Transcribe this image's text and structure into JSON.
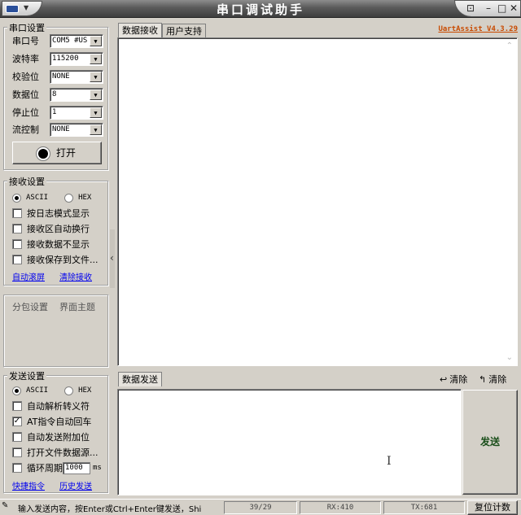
{
  "window": {
    "title": "串口调试助手"
  },
  "serial": {
    "group_title": "串口设置",
    "port_label": "串口号",
    "port_value": "COM5 #US",
    "baud_label": "波特率",
    "baud_value": "115200",
    "parity_label": "校验位",
    "parity_value": "NONE",
    "databits_label": "数据位",
    "databits_value": "8",
    "stopbits_label": "停止位",
    "stopbits_value": "1",
    "flow_label": "流控制",
    "flow_value": "NONE",
    "open_label": "打开"
  },
  "receive": {
    "group_title": "接收设置",
    "ascii": "ASCII",
    "hex": "HEX",
    "opt1": "按日志模式显示",
    "opt2": "接收区自动换行",
    "opt3": "接收数据不显示",
    "opt4": "接收保存到文件...",
    "link1": "自动滚屏",
    "link2": "清除接收"
  },
  "misc": {
    "packet": "分包设置",
    "theme": "界面主题"
  },
  "send": {
    "group_title": "发送设置",
    "ascii": "ASCII",
    "hex": "HEX",
    "opt1": "自动解析转义符",
    "opt2": "AT指令自动回车",
    "opt3": "自动发送附加位",
    "opt4": "打开文件数据源...",
    "opt5": "循环周期",
    "period_value": "1000",
    "period_unit": "ms",
    "link1": "快捷指令",
    "link2": "历史发送"
  },
  "tabs": {
    "receive": "数据接收",
    "support": "用户支持",
    "send": "数据发送"
  },
  "version": "UartAssist V4.3.29",
  "clear1": "清除",
  "clear2": "清除",
  "send_button": "发送",
  "status": {
    "hint": "输入发送内容，按Enter或Ctrl+Enter键发送，Shi",
    "count": "39/29",
    "rx": "RX:410",
    "tx": "TX:681",
    "reset": "复位计数"
  },
  "colors": {
    "version": "#c84a00",
    "link": "#0000ee"
  }
}
